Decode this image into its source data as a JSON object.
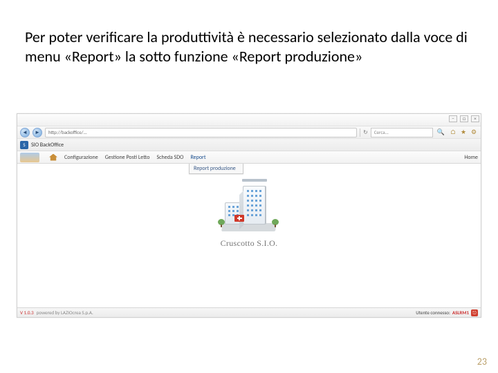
{
  "instruction_text": "Per poter verificare la produttività è necessario selezionato dalla voce di menu «Report» la sotto funzione «Report produzione»",
  "browser": {
    "url": "http://backoffice/...",
    "search_placeholder": "Cerca...",
    "tab_label": "SIO BackOffice"
  },
  "app": {
    "menu": {
      "items": [
        "Configurazione",
        "Gestione Posti Letto",
        "Scheda SDO",
        "Report"
      ],
      "home": "Home",
      "submenu": "Report produzione"
    },
    "title": "Cruscotto S.I.O."
  },
  "status": {
    "version": "V 1.0.3",
    "powered": "powered by LAZIOcrea S.p.A.",
    "user_label": "Utente connesso:",
    "user_name": "ASLRM1"
  },
  "page_number": "23"
}
